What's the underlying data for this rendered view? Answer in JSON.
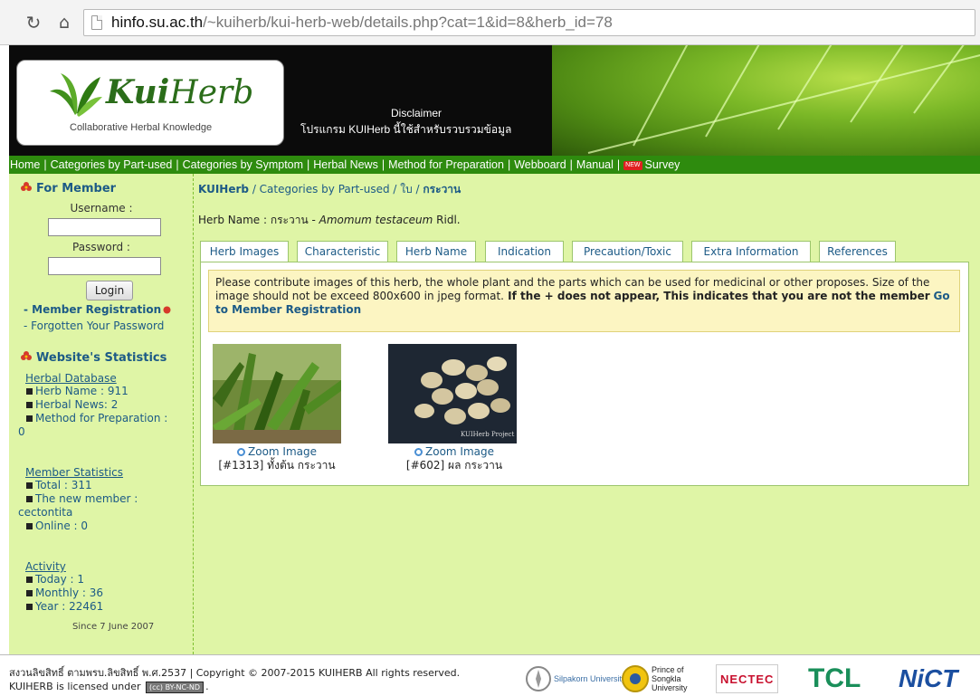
{
  "browser": {
    "url_host": "hinfo.su.ac.th",
    "url_path": "/~kuiherb/kui-herb-web/details.php?cat=1&id=8&herb_id=78"
  },
  "header": {
    "logo_kui": "Kui",
    "logo_herb": "Herb",
    "logo_tagline": "Collaborative Herbal Knowledge",
    "disclaimer_title": "Disclaimer",
    "disclaimer_text": "โปรแกรม KUIHerb นี้ใช้สำหรับรวบรวมข้อมูล"
  },
  "nav": {
    "items": [
      "Home",
      "Categories by Part-used",
      "Categories by Symptom",
      "Herbal News",
      "Method for Preparation",
      "Webboard",
      "Manual"
    ],
    "survey": "Survey",
    "new_badge": "NEW"
  },
  "sidebar": {
    "member_heading": "For Member",
    "username_label": "Username :",
    "password_label": "Password :",
    "login_button": "Login",
    "register_link": "- Member Registration",
    "forgot_link": "- Forgotten Your Password",
    "stats_heading": "Website's Statistics",
    "herbal_db_title": "Herbal Database",
    "herb_name_row": "Herb Name : 911",
    "herbal_news_row": "Herbal News: 2",
    "method_row": "Method for Preparation :",
    "method_value": "0",
    "member_stats_title": "Member Statistics",
    "total_row": "Total : 311",
    "new_member_row": "The new member :",
    "new_member_value": "cectontita",
    "online_row": "Online : 0",
    "activity_title": "Activity",
    "today_row": "Today : 1",
    "monthly_row": "Monthly : 36",
    "year_row": "Year : 22461",
    "since": "Since 7 June 2007"
  },
  "breadcrumb": {
    "root": "KUIHerb",
    "cat": "Categories by Part-used",
    "part": "ใบ",
    "current": "กระวาน"
  },
  "herb": {
    "label": "Herb Name : กระวาน - ",
    "scientific": "Amomum testaceum",
    "author": " Ridl."
  },
  "tabs": [
    "Herb Images",
    "Characteristic",
    "Herb Name",
    "Indication",
    "Precaution/Toxic",
    "Extra Information",
    "References"
  ],
  "notice": {
    "text": "Please contribute images of this herb, the whole plant and the parts which can be used for medicinal or other proposes. Size of the image should not be exceed 800x600 in jpeg format.",
    "bold": " If the + does not appear, This indicates that you are not the member",
    "link": "Go to Member Registration"
  },
  "images": [
    {
      "zoom": "Zoom Image",
      "caption": "[#1313] ทั้งต้น กระวาน"
    },
    {
      "zoom": "Zoom Image",
      "caption": "[#602] ผล กระวาน",
      "watermark": "KUIHerb Project"
    }
  ],
  "footer": {
    "copyright": "สงวนลิขสิทธิ์ ตามพรบ.ลิขสิทธิ์ พ.ศ.2537 | Copyright © 2007-2015 KUIHERB All rights reserved.",
    "license_prefix": "KUIHERB is licensed under",
    "license_cc": "(cc)",
    "license_badge": "BY-NC-ND",
    "sponsors": [
      "Silpakorn University",
      "Prince of Songkla University",
      "NECTEC",
      "TCL",
      "NiCT"
    ]
  },
  "colors": {
    "nav_green": "#2e8b0e",
    "content_bg": "#dff5a6",
    "link_blue": "#1c5a86",
    "notice_bg": "#fcf5c2"
  }
}
